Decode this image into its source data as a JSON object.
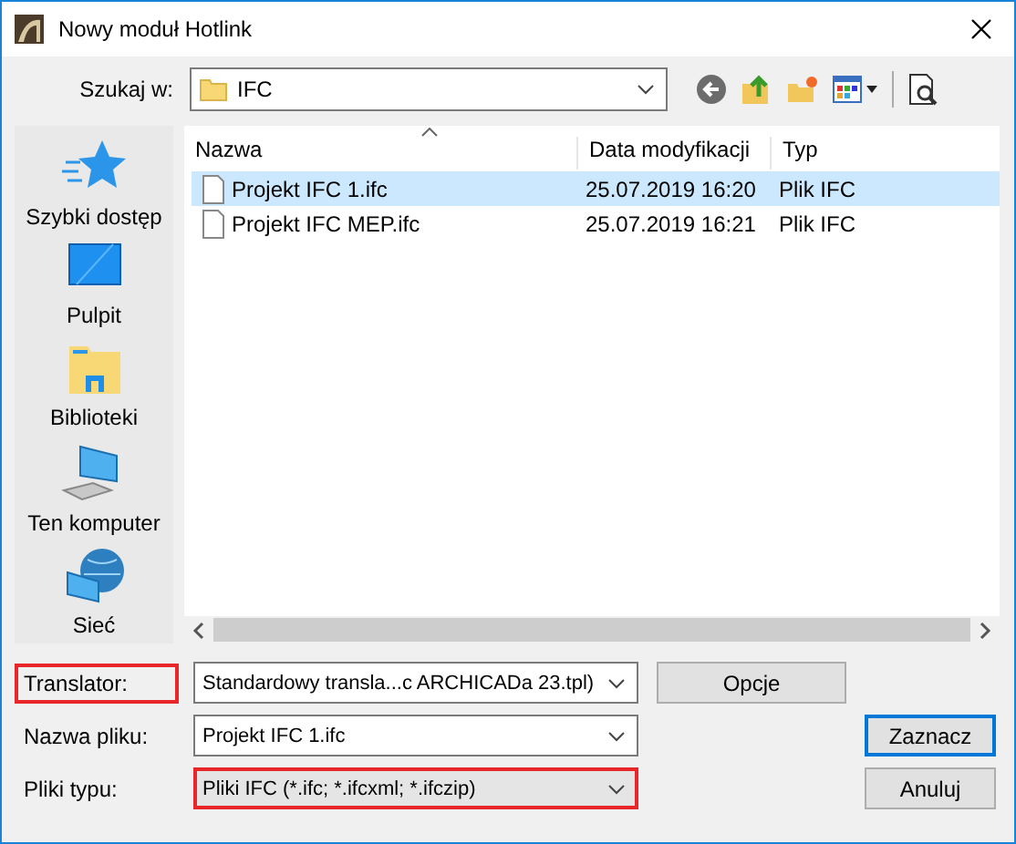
{
  "window": {
    "title": "Nowy moduł Hotlink"
  },
  "look_in": {
    "label": "Szukaj w:",
    "value": "IFC"
  },
  "sidebar": {
    "items": [
      {
        "kind": "star",
        "label": "Szybki dostęp"
      },
      {
        "kind": "desktop",
        "label": "Pulpit"
      },
      {
        "kind": "library",
        "label": "Biblioteki"
      },
      {
        "kind": "computer",
        "label": "Ten komputer"
      },
      {
        "kind": "network",
        "label": "Sieć"
      }
    ]
  },
  "table": {
    "columns": [
      "Nazwa",
      "Data modyfikacji",
      "Typ"
    ],
    "rows": [
      {
        "name": "Projekt IFC 1.ifc",
        "date": "25.07.2019 16:20",
        "type": "Plik IFC",
        "selected": true
      },
      {
        "name": "Projekt IFC MEP.ifc",
        "date": "25.07.2019 16:21",
        "type": "Plik IFC",
        "selected": false
      }
    ]
  },
  "form": {
    "translator": {
      "label": "Translator:",
      "value": "Standardowy transla...c ARCHICADa 23.tpl)",
      "highlighted": true
    },
    "options_button": "Opcje",
    "file_name": {
      "label": "Nazwa pliku:",
      "value": "Projekt IFC 1.ifc"
    },
    "file_type": {
      "label": "Pliki typu:",
      "value": "Pliki IFC (*.ifc; *.ifcxml; *.ifczip)",
      "highlighted": true
    },
    "ok_button": "Zaznacz",
    "cancel_button": "Anuluj"
  }
}
